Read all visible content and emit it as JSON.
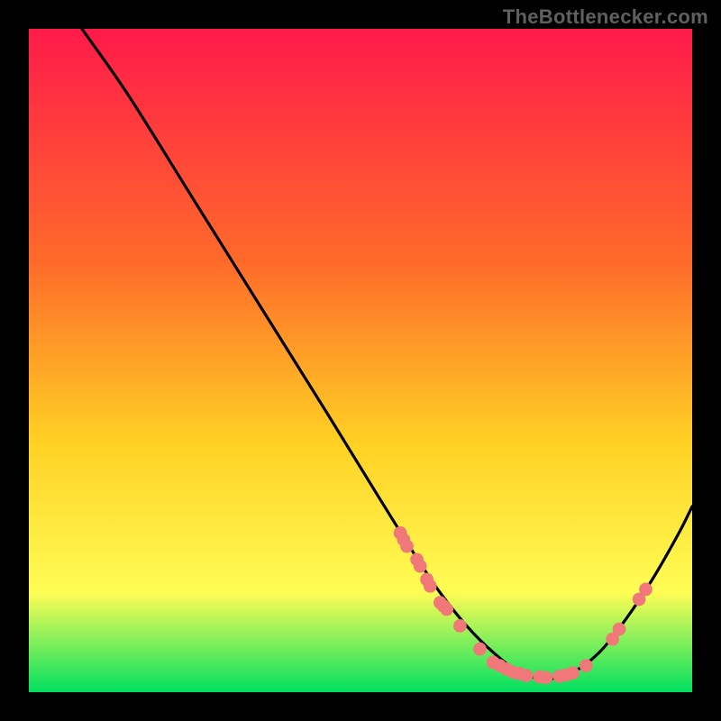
{
  "attribution": "TheBottlenecker.com",
  "colors": {
    "bg_top": "#ff1a4a",
    "bg_mid1": "#ff6a2a",
    "bg_mid2": "#ffd023",
    "bg_mid3": "#fffd55",
    "bg_bot": "#00e060",
    "curve": "#000000",
    "markers": "#f07878"
  },
  "chart_data": {
    "type": "line",
    "title": "",
    "xlabel": "",
    "ylabel": "",
    "xlim": [
      0,
      100
    ],
    "ylim": [
      0,
      100
    ],
    "grid": false,
    "legend": false,
    "series": [
      {
        "name": "curve",
        "x": [
          8,
          15,
          25,
          35,
          45,
          53,
          58,
          62,
          66,
          70,
          74,
          78,
          82,
          86,
          90,
          94,
          98,
          100
        ],
        "y": [
          100,
          90,
          74,
          58,
          42,
          29,
          21,
          15,
          10,
          6,
          3,
          2,
          3,
          6,
          11,
          17,
          24,
          28
        ]
      }
    ],
    "markers": [
      {
        "x": 56.0,
        "y": 24.0
      },
      {
        "x": 56.5,
        "y": 23.0
      },
      {
        "x": 57.0,
        "y": 22.0
      },
      {
        "x": 59.0,
        "y": 19.0
      },
      {
        "x": 58.5,
        "y": 20.0
      },
      {
        "x": 60.0,
        "y": 17.0
      },
      {
        "x": 60.5,
        "y": 16.0
      },
      {
        "x": 62.0,
        "y": 13.5
      },
      {
        "x": 62.5,
        "y": 13.0
      },
      {
        "x": 63.0,
        "y": 12.5
      },
      {
        "x": 65.0,
        "y": 10.0
      },
      {
        "x": 68.0,
        "y": 6.5
      },
      {
        "x": 70.0,
        "y": 4.5
      },
      {
        "x": 71.0,
        "y": 4.0
      },
      {
        "x": 72.0,
        "y": 3.5
      },
      {
        "x": 73.0,
        "y": 3.0
      },
      {
        "x": 74.0,
        "y": 2.8
      },
      {
        "x": 75.0,
        "y": 2.5
      },
      {
        "x": 77.0,
        "y": 2.3
      },
      {
        "x": 78.0,
        "y": 2.2
      },
      {
        "x": 80.0,
        "y": 2.4
      },
      {
        "x": 81.0,
        "y": 2.6
      },
      {
        "x": 82.0,
        "y": 2.9
      },
      {
        "x": 84.0,
        "y": 4.0
      },
      {
        "x": 88.0,
        "y": 8.0
      },
      {
        "x": 89.0,
        "y": 9.5
      },
      {
        "x": 92.0,
        "y": 14.0
      },
      {
        "x": 93.0,
        "y": 15.5
      }
    ],
    "marker_radius": 1.0
  }
}
